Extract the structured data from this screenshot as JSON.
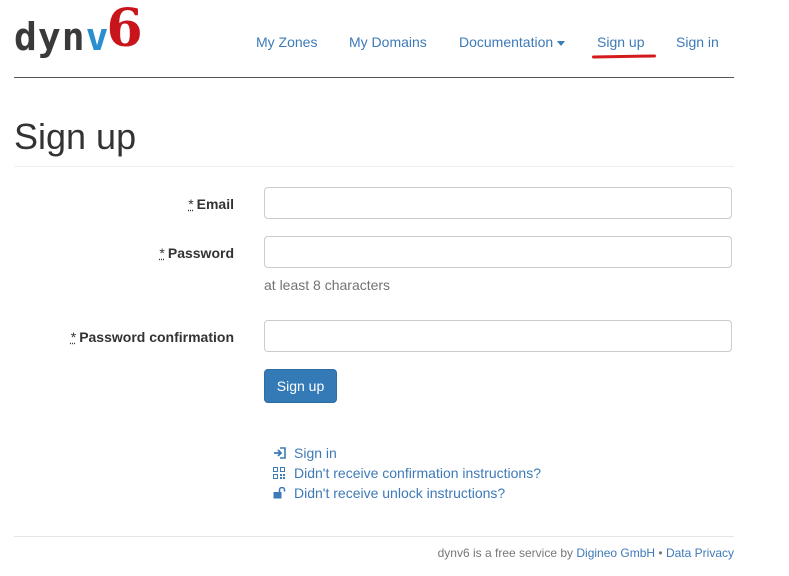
{
  "brand": {
    "part1": "dyn",
    "part2": "v",
    "part3": "6"
  },
  "nav": {
    "my_zones": "My Zones",
    "my_domains": "My Domains",
    "documentation": "Documentation",
    "sign_up": "Sign up",
    "sign_in": "Sign in"
  },
  "page": {
    "title": "Sign up"
  },
  "form": {
    "required_mark": "*",
    "email_label": "Email",
    "password_label": "Password",
    "password_help": "at least 8 characters",
    "password_confirmation_label": "Password confirmation",
    "submit_label": "Sign up"
  },
  "links": {
    "sign_in": "Sign in",
    "confirmation": "Didn't receive confirmation instructions?",
    "unlock": "Didn't receive unlock instructions?"
  },
  "footer": {
    "text": "dynv6 is a free service by",
    "company": "Digineo GmbH",
    "separator": "•",
    "privacy": "Data Privacy"
  },
  "colors": {
    "accent": "#337ab7",
    "link": "#3d7ab8",
    "brand_red": "#c8151c",
    "brand_blue": "#2a8fd0"
  }
}
